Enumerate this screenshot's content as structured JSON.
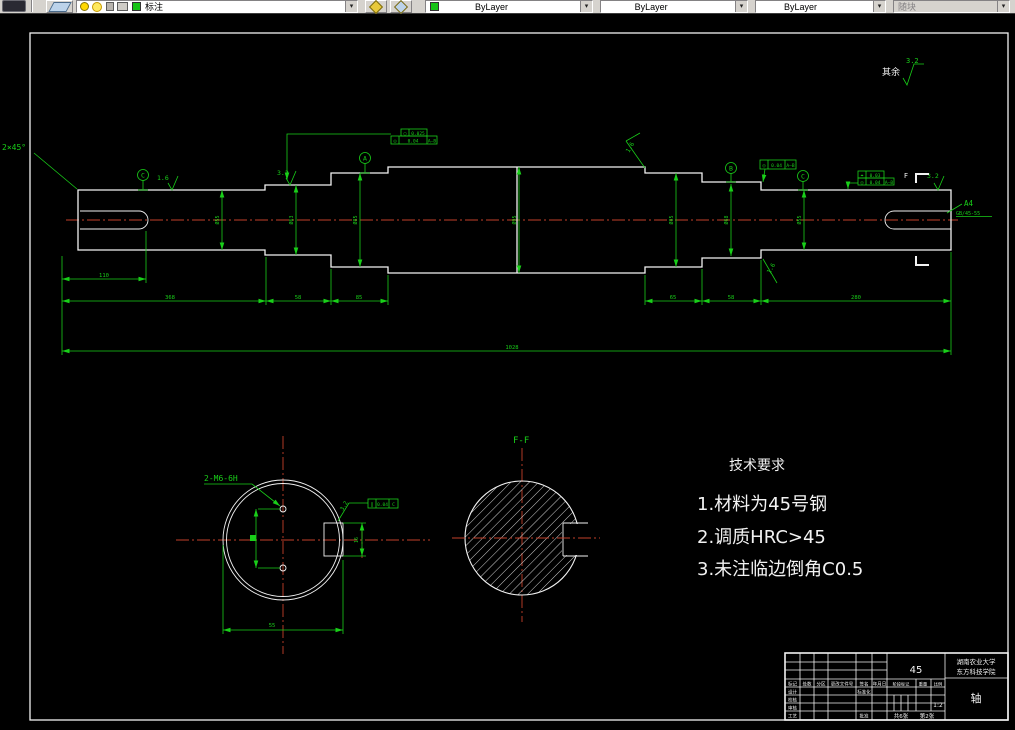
{
  "toolbar": {
    "layer": "标注",
    "color": "ByLayer",
    "linetype": "ByLayer",
    "lineweight": "ByLayer",
    "plot_style": "随块",
    "dropdown_glyph": "▾"
  },
  "annotations": {
    "general_roughness_label": "其余",
    "general_roughness_value": "3.2",
    "chamfer": "2×45°",
    "datum_left": "C",
    "datum_a": "A",
    "datum_b": "B",
    "datum_right": "C",
    "rough_1": "1.6",
    "rough_2": "3.2",
    "rough_3": "1.6",
    "rough_4": "3.2",
    "rough_5": "1.6",
    "key_note_1": "A4",
    "key_note_2": "GB/45-55",
    "section_mark": "F",
    "fcf1a_sym": "○",
    "fcf1a_val": "0.025",
    "fcf1b_sym": "◎",
    "fcf1b_val": "0.04",
    "fcf1b_ref": "A–B",
    "fcf2_sym": "◎",
    "fcf2_val": "0.04",
    "fcf2_ref": "A–B",
    "fcf3a_sym": "⌖",
    "fcf3a_val": "0.03",
    "fcf3b_sym": "◎",
    "fcf3b_val": "0.04",
    "fcf3b_ref": "A–B"
  },
  "dims": {
    "keyway_len": "110",
    "seg1": "368",
    "seg2": "58",
    "seg3": "85",
    "seg4": "65",
    "seg5": "58",
    "seg6": "280",
    "overall": "1028",
    "dia_a": "Ø55",
    "dia_b": "Ø63",
    "dia_c": "Ø85",
    "dia_d": "Ø95",
    "dia_f": "Ø85",
    "dia_g": "Ø68",
    "dia_h": "Ø55"
  },
  "left_view": {
    "thread_note": "2-M6-6H",
    "rough": "3.2",
    "fcf_sym": "∥",
    "fcf_val": "0.04",
    "fcf_ref": "C",
    "key_width": "16",
    "diameter": "55"
  },
  "section_view": {
    "label": "F-F"
  },
  "tech_req": {
    "title": "技术要求",
    "item1": "1.材料为45号钢",
    "item2": "2.调质HRC>45",
    "item3": "3.未注临边倒角C0.5"
  },
  "title_block": {
    "material": "45",
    "org1": "湖南农业大学",
    "org2": "东方科技学院",
    "part": "轴",
    "scale": "1:2",
    "sheets_total": "共6张",
    "sheet_no": "第2张",
    "h1": "标记",
    "h2": "处数",
    "h3": "分区",
    "h4": "更改文件号",
    "h5": "签名",
    "h6": "年月日",
    "r1": "设计",
    "r2": "校核",
    "r3": "审核",
    "r4": "工艺",
    "c1": "标准化",
    "c2": "批准",
    "m1": "阶段标记",
    "m2": "重量",
    "m3": "比例"
  }
}
